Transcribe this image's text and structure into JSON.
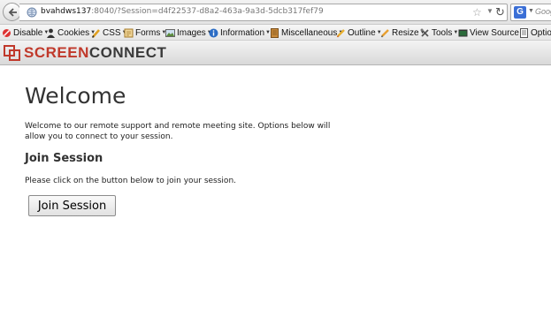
{
  "browser": {
    "url_host": "bvahdws137",
    "url_rest": ":8040/?Session=d4f22537-d8a2-463a-9a3d-5dcb317fef79",
    "search_engine_icon": "G",
    "search_placeholder": "Goog",
    "icons": [
      "back-arrow-icon",
      "globe-icon",
      "star-icon",
      "reload-icon",
      "google-icon"
    ]
  },
  "devtoolbar": {
    "items": [
      {
        "label": "Disable",
        "icon": "disable-icon"
      },
      {
        "label": "Cookies",
        "icon": "cookies-icon"
      },
      {
        "label": "CSS",
        "icon": "css-icon"
      },
      {
        "label": "Forms",
        "icon": "forms-icon"
      },
      {
        "label": "Images",
        "icon": "images-icon"
      },
      {
        "label": "Information",
        "icon": "information-icon"
      },
      {
        "label": "Miscellaneous",
        "icon": "miscellaneous-icon"
      },
      {
        "label": "Outline",
        "icon": "outline-icon"
      },
      {
        "label": "Resize",
        "icon": "resize-icon"
      },
      {
        "label": "Tools",
        "icon": "tools-icon"
      },
      {
        "label": "View Source",
        "icon": "view-source-icon"
      },
      {
        "label": "Optio",
        "icon": "options-icon"
      }
    ]
  },
  "brand": {
    "part1": "Screen",
    "part2": "Connect",
    "accent_color": "#c0392b"
  },
  "main": {
    "title": "Welcome",
    "intro": "Welcome to our remote support and remote meeting site. Options below will allow you to connect to your session.",
    "section_heading": "Join Session",
    "instruction": "Please click on the button below to join your session.",
    "join_button": "Join Session"
  }
}
